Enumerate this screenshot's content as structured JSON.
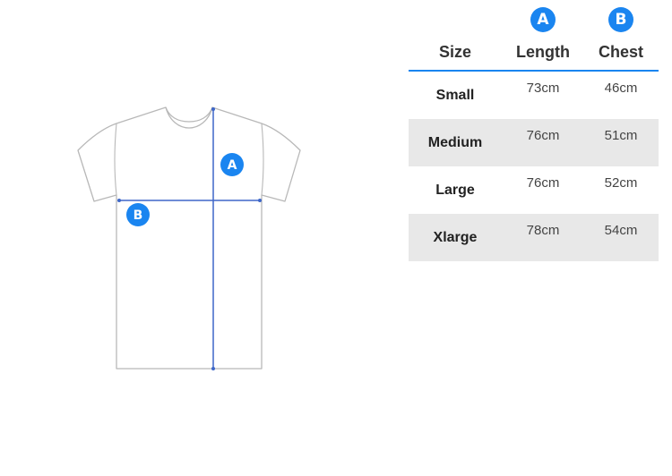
{
  "diagram": {
    "badge_a": "A",
    "badge_b": "B",
    "colors": {
      "outline": "#b8b8b8",
      "accent": "#1a85f0",
      "measure_line": "#3e67c8"
    }
  },
  "table": {
    "badges": {
      "length": "A",
      "chest": "B"
    },
    "headers": {
      "size": "Size",
      "length": "Length",
      "chest": "Chest"
    },
    "rows": [
      {
        "size": "Small",
        "length": "73cm",
        "chest": "46cm"
      },
      {
        "size": "Medium",
        "length": "76cm",
        "chest": "51cm"
      },
      {
        "size": "Large",
        "length": "76cm",
        "chest": "52cm"
      },
      {
        "size": "Xlarge",
        "length": "78cm",
        "chest": "54cm"
      }
    ],
    "colors": {
      "header_rule": "#1a85f0",
      "stripe": "#e8e8e8"
    }
  }
}
